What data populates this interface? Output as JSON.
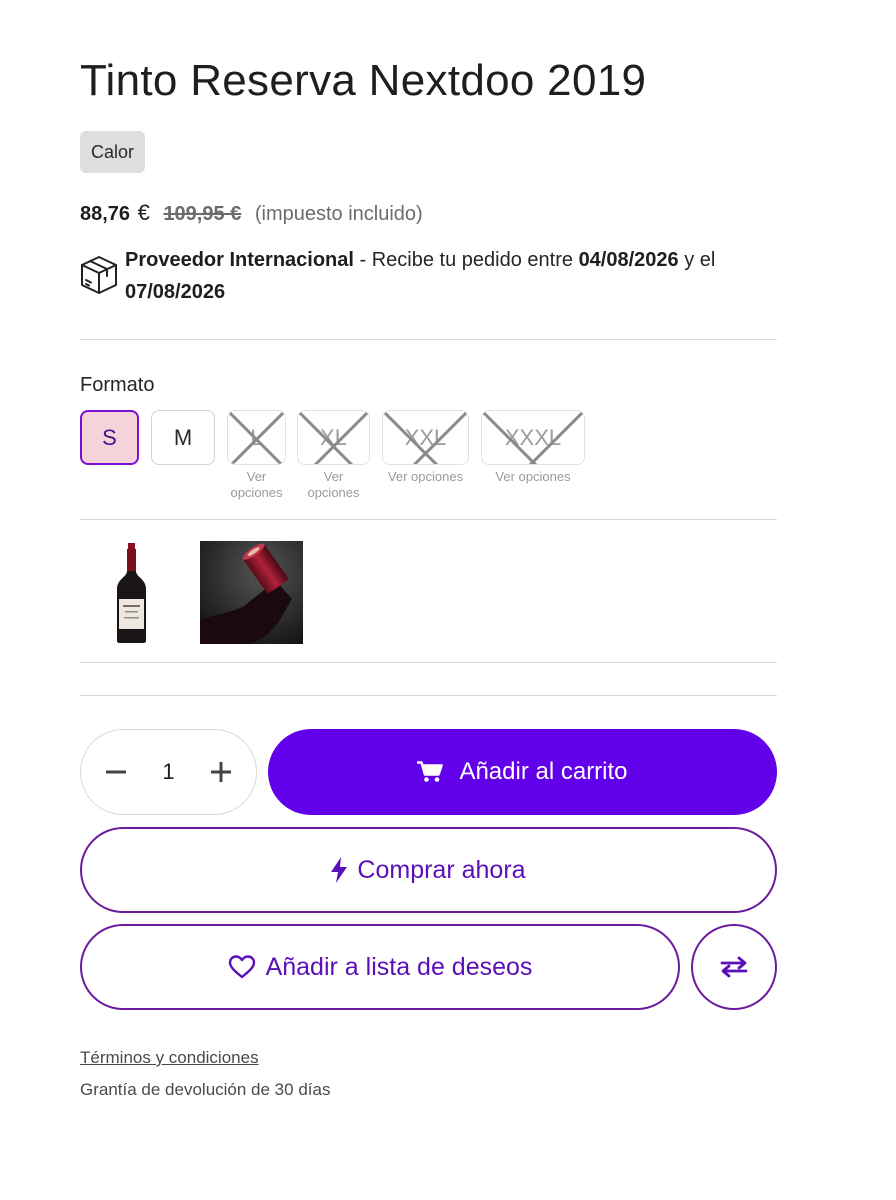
{
  "product": {
    "title": "Tinto Reserva Nextdoo 2019",
    "tag": "Calor"
  },
  "price": {
    "current": "88,76",
    "currency": "€",
    "original": "109,95 €",
    "tax_note": "(impuesto incluido)"
  },
  "delivery": {
    "icon": "package-box-icon",
    "provider": "Proveedor Internacional",
    "text": " - Recibe tu pedido entre ",
    "date_from": "04/08/2026",
    "connector": " y el ",
    "date_to": "07/08/2026"
  },
  "format": {
    "label": "Formato",
    "sizes": [
      {
        "label": "S",
        "state": "selected"
      },
      {
        "label": "M",
        "state": "available"
      },
      {
        "label": "L",
        "state": "unavailable",
        "note_line1": "Ver",
        "note_line2": "opciones"
      },
      {
        "label": "XL",
        "state": "unavailable",
        "note_line1": "Ver",
        "note_line2": "opciones"
      },
      {
        "label": "XXL",
        "state": "unavailable",
        "note_line1": "Ver opciones"
      },
      {
        "label": "XXXL",
        "state": "unavailable",
        "note_line1": "Ver opciones"
      }
    ]
  },
  "thumbnails": [
    {
      "name": "wine-bottle-image"
    },
    {
      "name": "bottle-cork-closeup-image"
    }
  ],
  "purchase": {
    "quantity": "1",
    "add_to_cart": "Añadir al carrito",
    "buy_now": "Comprar ahora",
    "wishlist": "Añadir a lista de deseos"
  },
  "footer": {
    "terms": "Términos y condiciones",
    "guarantee": "Grantía de devolución de 30 días"
  },
  "colors": {
    "accent": "#6200ea",
    "outline": "#6b1a9e",
    "selected_bg": "#f4d3da"
  }
}
